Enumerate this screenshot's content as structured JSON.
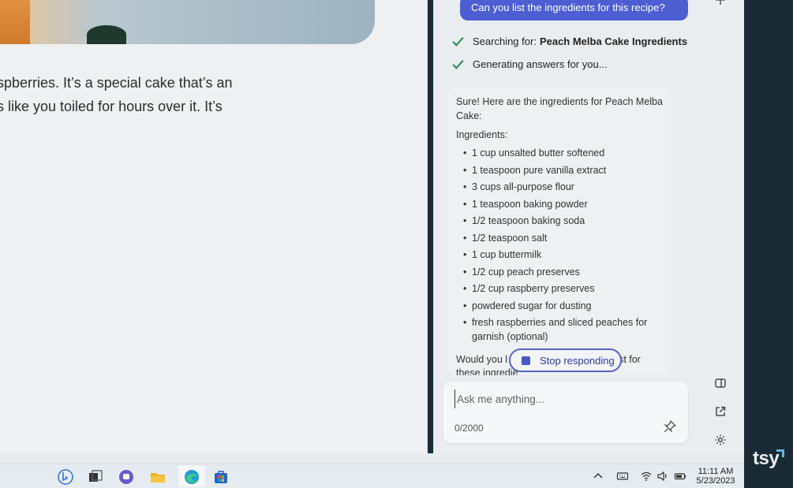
{
  "article": {
    "lines": [
      "spberries. It’s a special cake that’s an",
      "s like you toiled for hours over it. It’s"
    ]
  },
  "chat": {
    "user_message": "Can you list the ingredients for this recipe?",
    "status": {
      "searching_prefix": "Searching for:",
      "searching_query": "Peach Melba Cake Ingredients",
      "generating": "Generating answers for you..."
    },
    "answer": {
      "intro": "Sure! Here are the ingredients for Peach Melba Cake:",
      "ingredients_heading": "Ingredients:",
      "ingredients": [
        "1 cup unsalted butter softened",
        "1 teaspoon pure vanilla extract",
        "3 cups all-purpose flour",
        "1 teaspoon baking powder",
        "1/2 teaspoon baking soda",
        "1/2 teaspoon salt",
        "1 cup buttermilk",
        "1/2 cup peach preserves",
        "1/2 cup raspberry preserves",
        "powdered sugar for dusting",
        "fresh raspberries and sliced peaches for garnish (optional)"
      ],
      "closing_left": "Would you l",
      "closing_right": "st for",
      "closing_line2": "these ingredie"
    },
    "stop_label": "Stop responding",
    "composer": {
      "placeholder": "Ask me anything...",
      "counter": "0/2000"
    }
  },
  "taskbar": {
    "time": "11:11 AM",
    "date": "5/23/2023"
  },
  "watermark": "tsy",
  "colors": {
    "accent": "#4c5ed2",
    "check": "#2e8b57",
    "dark_strip": "#1a2a35"
  }
}
